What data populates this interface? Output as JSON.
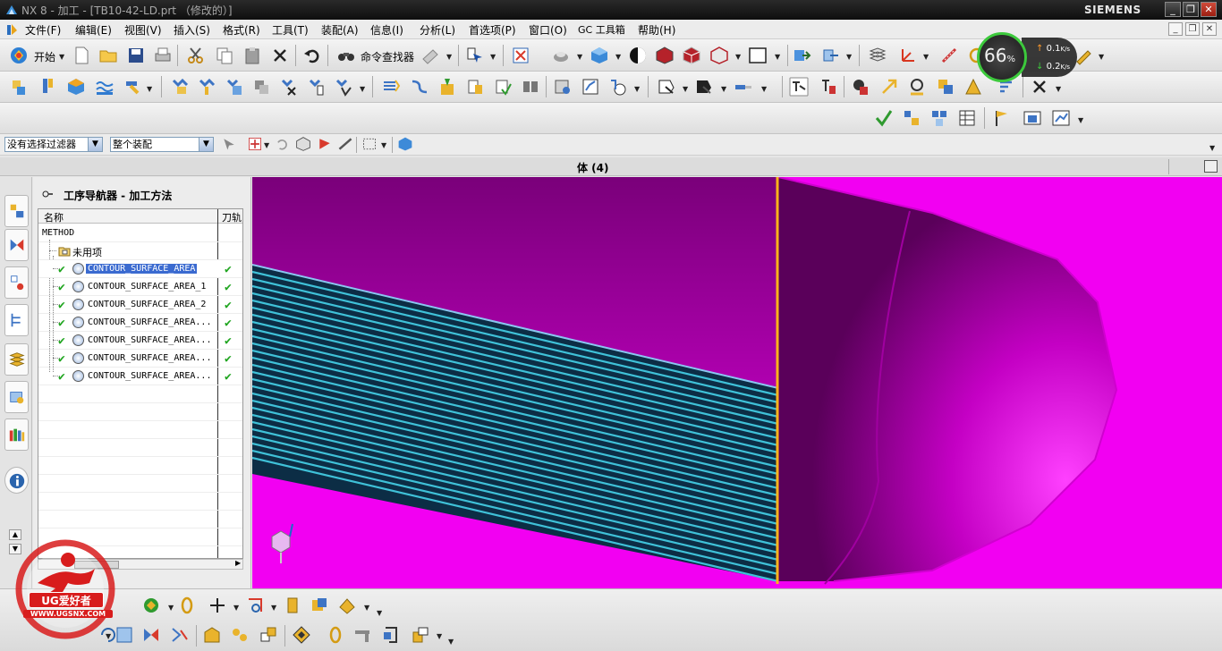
{
  "window": {
    "title": "NX 8 - 加工 - [TB10-42-LD.prt （修改的）]",
    "brand": "SIEMENS",
    "controls": [
      "_",
      "❐",
      "✕"
    ]
  },
  "menu": {
    "items": [
      "文件(F)",
      "编辑(E)",
      "视图(V)",
      "插入(S)",
      "格式(R)",
      "工具(T)",
      "装配(A)",
      "信息(I)",
      "分析(L)",
      "首选项(P)",
      "窗口(O)",
      "GC 工具箱",
      "帮助(H)"
    ]
  },
  "toolbar": {
    "start_label": "开始",
    "command_finder_label": "命令查找器"
  },
  "filter": {
    "selection_filter": "没有选择过滤器",
    "assembly_scope": "整个装配"
  },
  "viewport": {
    "title": "体 (4)",
    "background_color": "#f200f2"
  },
  "navigator": {
    "title": "工序导航器 - 加工方法",
    "columns": [
      "名称",
      "刀轨"
    ],
    "root": "METHOD",
    "group": "未用项",
    "operations": [
      {
        "name": "CONTOUR_SURFACE_AREA",
        "selected": true
      },
      {
        "name": "CONTOUR_SURFACE_AREA_1",
        "selected": false
      },
      {
        "name": "CONTOUR_SURFACE_AREA_2",
        "selected": false
      },
      {
        "name": "CONTOUR_SURFACE_AREA...",
        "selected": false
      },
      {
        "name": "CONTOUR_SURFACE_AREA...",
        "selected": false
      },
      {
        "name": "CONTOUR_SURFACE_AREA...",
        "selected": false
      },
      {
        "name": "CONTOUR_SURFACE_AREA...",
        "selected": false
      }
    ]
  },
  "network_widget": {
    "percent": "66",
    "percent_unit": "%",
    "upload": "0.1",
    "download": "0.2",
    "unit": "K/s"
  },
  "watermark": {
    "text": "UG爱好者",
    "url": "WWW.UGSNX.COM"
  }
}
